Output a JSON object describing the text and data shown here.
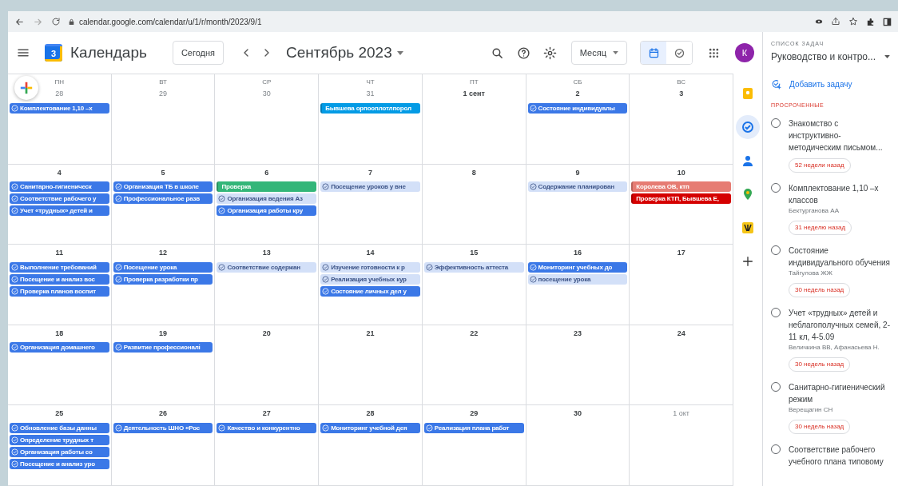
{
  "browser": {
    "url": "calendar.google.com/calendar/u/1/r/month/2023/9/1"
  },
  "header": {
    "logo_text": "3",
    "app_name": "Календарь",
    "today_button": "Сегодня",
    "period": "Сентябрь 2023",
    "view_select": "Месяц",
    "avatar": "К",
    "view_toggle": [
      {
        "kind": "calendar",
        "selected": true
      },
      {
        "kind": "tasks",
        "selected": false
      }
    ]
  },
  "weekdays": [
    "ПН",
    "ВТ",
    "СР",
    "ЧТ",
    "ПТ",
    "СБ",
    "ВС"
  ],
  "weeks": [
    [
      {
        "date": "28",
        "other_month": true,
        "items": [
          {
            "kind": "task",
            "done": false,
            "text": "Комплектование 1,10 –х"
          }
        ]
      },
      {
        "date": "29",
        "other_month": true
      },
      {
        "date": "30",
        "other_month": true
      },
      {
        "date": "31",
        "other_month": true,
        "items": [
          {
            "kind": "event",
            "color": "#039be5",
            "text": "Бывшева орпооплотлпорол"
          }
        ]
      },
      {
        "date": "1 сент",
        "other_month": false
      },
      {
        "date": "2",
        "other_month": false,
        "items": [
          {
            "kind": "task",
            "done": false,
            "text": "Состояние индивидуалы"
          }
        ]
      },
      {
        "date": "3",
        "other_month": false
      }
    ],
    [
      {
        "date": "4",
        "other_month": false,
        "items": [
          {
            "kind": "task",
            "done": false,
            "text": "Санитарно-гигиеническ"
          },
          {
            "kind": "task",
            "done": false,
            "text": "Соответствие рабочего у"
          },
          {
            "kind": "task",
            "done": false,
            "text": "Учет «трудных» детей и"
          }
        ]
      },
      {
        "date": "5",
        "other_month": false,
        "items": [
          {
            "kind": "task",
            "done": false,
            "text": "Организация ТБ в школе"
          },
          {
            "kind": "task",
            "done": false,
            "text": "Профессиональное разв"
          }
        ]
      },
      {
        "date": "6",
        "other_month": false,
        "items": [
          {
            "kind": "event",
            "color": "#33b679",
            "text": "Проверка"
          },
          {
            "kind": "task",
            "done": true,
            "text": "Организация ведения Аз"
          },
          {
            "kind": "task",
            "done": false,
            "text": "Организация работы кру"
          }
        ]
      },
      {
        "date": "7",
        "other_month": false,
        "items": [
          {
            "kind": "task",
            "done": true,
            "text": "Посещение уроков у вне"
          }
        ]
      },
      {
        "date": "8",
        "other_month": false
      },
      {
        "date": "9",
        "other_month": false,
        "items": [
          {
            "kind": "task",
            "done": true,
            "text": "Содержание планирован"
          }
        ]
      },
      {
        "date": "10",
        "other_month": false,
        "items": [
          {
            "kind": "event",
            "color": "#e67c73",
            "text": "Королева ОВ, ктп"
          },
          {
            "kind": "event",
            "color": "#d50000",
            "text": "Проверка КТП, Бывшева Е,"
          }
        ]
      }
    ],
    [
      {
        "date": "11",
        "other_month": false,
        "items": [
          {
            "kind": "task",
            "done": false,
            "text": "Выполнение требований"
          },
          {
            "kind": "task",
            "done": false,
            "text": "Посещение и анализ вос"
          },
          {
            "kind": "task",
            "done": false,
            "text": "Проверка планов воспит"
          }
        ]
      },
      {
        "date": "12",
        "other_month": false,
        "items": [
          {
            "kind": "task",
            "done": false,
            "text": "Посещение урока"
          },
          {
            "kind": "task",
            "done": false,
            "text": "Проверка разработки пр"
          }
        ]
      },
      {
        "date": "13",
        "other_month": false,
        "items": [
          {
            "kind": "task",
            "done": true,
            "text": "Соответствие содержан"
          }
        ]
      },
      {
        "date": "14",
        "other_month": false,
        "items": [
          {
            "kind": "task",
            "done": true,
            "text": "Изучение готовности к р"
          },
          {
            "kind": "task",
            "done": true,
            "text": "Реализация учебных кур"
          },
          {
            "kind": "task",
            "done": false,
            "text": "Состояние личных дел у"
          }
        ]
      },
      {
        "date": "15",
        "other_month": false,
        "items": [
          {
            "kind": "task",
            "done": true,
            "text": "Эффективность аттеста"
          }
        ]
      },
      {
        "date": "16",
        "other_month": false,
        "items": [
          {
            "kind": "task",
            "done": false,
            "text": "Мониторинг учебных до"
          },
          {
            "kind": "task",
            "done": true,
            "text": "посещение урока"
          }
        ]
      },
      {
        "date": "17",
        "other_month": false
      }
    ],
    [
      {
        "date": "18",
        "other_month": false,
        "items": [
          {
            "kind": "task",
            "done": false,
            "text": "Организация домашнего"
          }
        ]
      },
      {
        "date": "19",
        "other_month": false,
        "items": [
          {
            "kind": "task",
            "done": false,
            "text": "Развитие профессионалі"
          }
        ]
      },
      {
        "date": "20",
        "other_month": false
      },
      {
        "date": "21",
        "other_month": false
      },
      {
        "date": "22",
        "other_month": false
      },
      {
        "date": "23",
        "other_month": false
      },
      {
        "date": "24",
        "other_month": false
      }
    ],
    [
      {
        "date": "25",
        "other_month": false,
        "items": [
          {
            "kind": "task",
            "done": false,
            "text": "Обновление базы данны"
          },
          {
            "kind": "task",
            "done": false,
            "text": "Определение трудных т"
          },
          {
            "kind": "task",
            "done": false,
            "text": "Организация работы со"
          },
          {
            "kind": "task",
            "done": false,
            "text": "Посещение и анализ уро"
          }
        ]
      },
      {
        "date": "26",
        "other_month": false,
        "items": [
          {
            "kind": "task",
            "done": false,
            "text": "Деятельность ШНО «Рос"
          }
        ]
      },
      {
        "date": "27",
        "other_month": false,
        "items": [
          {
            "kind": "task",
            "done": false,
            "text": "Качество и конкурентно"
          }
        ]
      },
      {
        "date": "28",
        "other_month": false,
        "items": [
          {
            "kind": "task",
            "done": false,
            "text": "Мониторинг учебной дея"
          }
        ]
      },
      {
        "date": "29",
        "other_month": false,
        "items": [
          {
            "kind": "task",
            "done": false,
            "text": "Реализация плана работ"
          }
        ]
      },
      {
        "date": "30",
        "other_month": false
      },
      {
        "date": "1 окт",
        "other_month": true
      }
    ]
  ],
  "side_apps": [
    {
      "kind": "keep",
      "selected": false
    },
    {
      "kind": "tasks",
      "selected": true
    },
    {
      "kind": "contacts",
      "selected": false
    },
    {
      "kind": "maps",
      "selected": false
    },
    {
      "kind": "addon",
      "selected": false
    },
    {
      "kind": "add",
      "selected": false
    }
  ],
  "tasks_panel": {
    "caption": "СПИСОК ЗАДАЧ",
    "list_name": "Руководство и контро...",
    "add_task": "Добавить задачу",
    "section": "ПРОСРОЧЕННЫЕ",
    "tasks": [
      {
        "checked": false,
        "title": "Знакомство с инструктивно-методическим письмом...",
        "due": "52 недели назад"
      },
      {
        "checked": false,
        "title": "Комплектование 1,10 –х классов",
        "assignee": "Бектурганова АА",
        "due": "31 неделю назад"
      },
      {
        "checked": false,
        "title": "Состояние индивидуального обучения",
        "assignee": "Тайгулова ЖЖ",
        "due": "30 недель назад"
      },
      {
        "checked": false,
        "title": "Учет «трудных» детей и неблагополучных семей, 2-11 кл, 4-5.09",
        "assignee": "Величкина ВВ, Афанасьева Н.",
        "due": "30 недель назад"
      },
      {
        "checked": false,
        "title": "Санитарно-гигиенический режим",
        "assignee": "Верещагин СН",
        "due": "30 недель назад"
      },
      {
        "checked": false,
        "title": "Соответствие рабочего учебного плана типовому"
      }
    ]
  }
}
